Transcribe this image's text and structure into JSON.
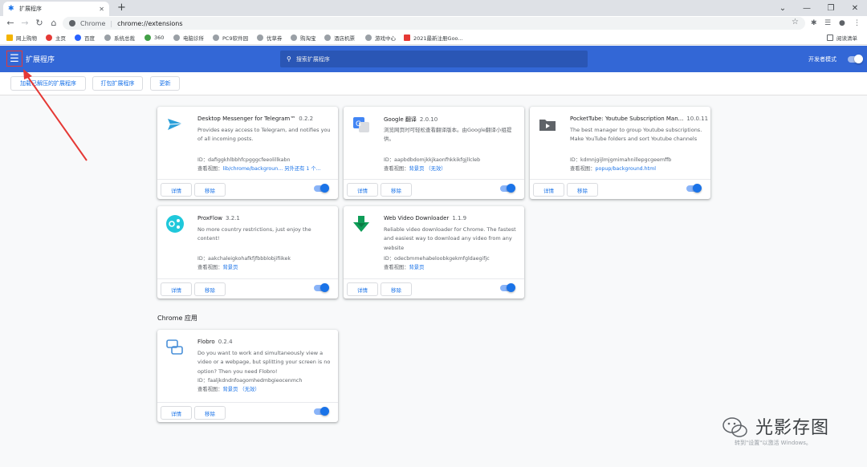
{
  "browser": {
    "tab_title": "扩展程序",
    "new_tab": "+",
    "scheme_label": "Chrome",
    "url": "chrome://extensions",
    "reading_list": "阅读清单"
  },
  "bookmarks": [
    {
      "label": "网上购物",
      "color": "#f4b400"
    },
    {
      "label": "主页",
      "color": "#e53935"
    },
    {
      "label": "百度",
      "color": "#2962ff"
    },
    {
      "label": "系统总裁",
      "color": "#5f6368"
    },
    {
      "label": "360",
      "color": "#43a047"
    },
    {
      "label": "电脑诊所",
      "color": "#5f6368"
    },
    {
      "label": "PC9软件园",
      "color": "#5f6368"
    },
    {
      "label": "优草券",
      "color": "#5f6368"
    },
    {
      "label": "购淘宝",
      "color": "#5f6368"
    },
    {
      "label": "酒店机票",
      "color": "#5f6368"
    },
    {
      "label": "游戏中心",
      "color": "#5f6368"
    },
    {
      "label": "2021最新注册Goo...",
      "color": "#e53935"
    }
  ],
  "header": {
    "title": "扩展程序",
    "search_placeholder": "搜索扩展程序",
    "dev_mode_label": "开发者模式"
  },
  "devbar": {
    "load_unpacked": "加载已解压的扩展程序",
    "pack": "打包扩展程序",
    "update": "更新"
  },
  "cards": [
    {
      "name": "Desktop Messenger for Telegram™",
      "version": "0.2.2",
      "desc": "Provides easy access to Telegram, and notifies you of all incoming posts.",
      "id": "ID：dafiggkhlbbhfcpgggcfeeolillkabn",
      "views_label": "查看视图",
      "views_link": "lib/chrome/backgroun...  另外还有 1 个...",
      "details": "详情",
      "remove": "移除",
      "icon": "paper-plane-icon"
    },
    {
      "name": "Google 翻译",
      "version": "2.0.10",
      "desc": "浏览网页时可轻松查看翻译版本。由Google翻译小组提供。",
      "id": "ID：aapbdbdomjkkjkaonfhkkikfgjllcleb",
      "views_label": "查看视图",
      "views_link": "背景页 （无效）",
      "details": "详情",
      "remove": "移除",
      "icon": "translate-icon"
    },
    {
      "name": "PocketTube: Youtube Subscription Man...",
      "version": "10.0.11",
      "desc": "The best manager to group Youtube subscriptions. Make YouTube folders and sort Youtube channels",
      "id": "ID：kdmnjgijlmjgmimahnillepgcgeemffb",
      "views_label": "查看视图",
      "views_link": "popup/background.html",
      "details": "详情",
      "remove": "移除",
      "icon": "folder-icon"
    },
    {
      "name": "ProxFlow",
      "version": "3.2.1",
      "desc": "No more country restrictions, just enjoy the content!",
      "id": "ID：aakchaleigkohafkfjfbbblobjifiikek",
      "views_label": "查看视图",
      "views_link": "背景页",
      "details": "详情",
      "remove": "移除",
      "icon": "proxy-icon"
    },
    {
      "name": "Web Video Downloader",
      "version": "1.1.9",
      "desc": "Reliable video downloader for Chrome. The fastest and easiest way to download any video from any website",
      "id": "ID：odecbmmehabeloobkgekmfgldaegifjc",
      "views_label": "查看视图",
      "views_link": "背景页",
      "details": "详情",
      "remove": "移除",
      "icon": "download-icon"
    }
  ],
  "apps_section": {
    "title": "Chrome 应用",
    "card": {
      "name": "Flobro",
      "version": "0.2.4",
      "desc": "Do you want to work and simultaneously view a video or a webpage, but splitting your screen is no option? Then you need Flobro!",
      "id": "ID：faaljkdndnfoagomhedmbgieocenmch",
      "views_label": "查看视图",
      "views_link": "背景页 （无效）",
      "details": "详情",
      "remove": "移除",
      "icon": "flobro-icon"
    }
  },
  "watermark": {
    "text": "光影存图",
    "sub": "转到\"设置\"以激活 Windows。"
  },
  "colors": {
    "header_blue": "#3367d6",
    "link_blue": "#1a73e8",
    "annotation_red": "#e53935"
  }
}
